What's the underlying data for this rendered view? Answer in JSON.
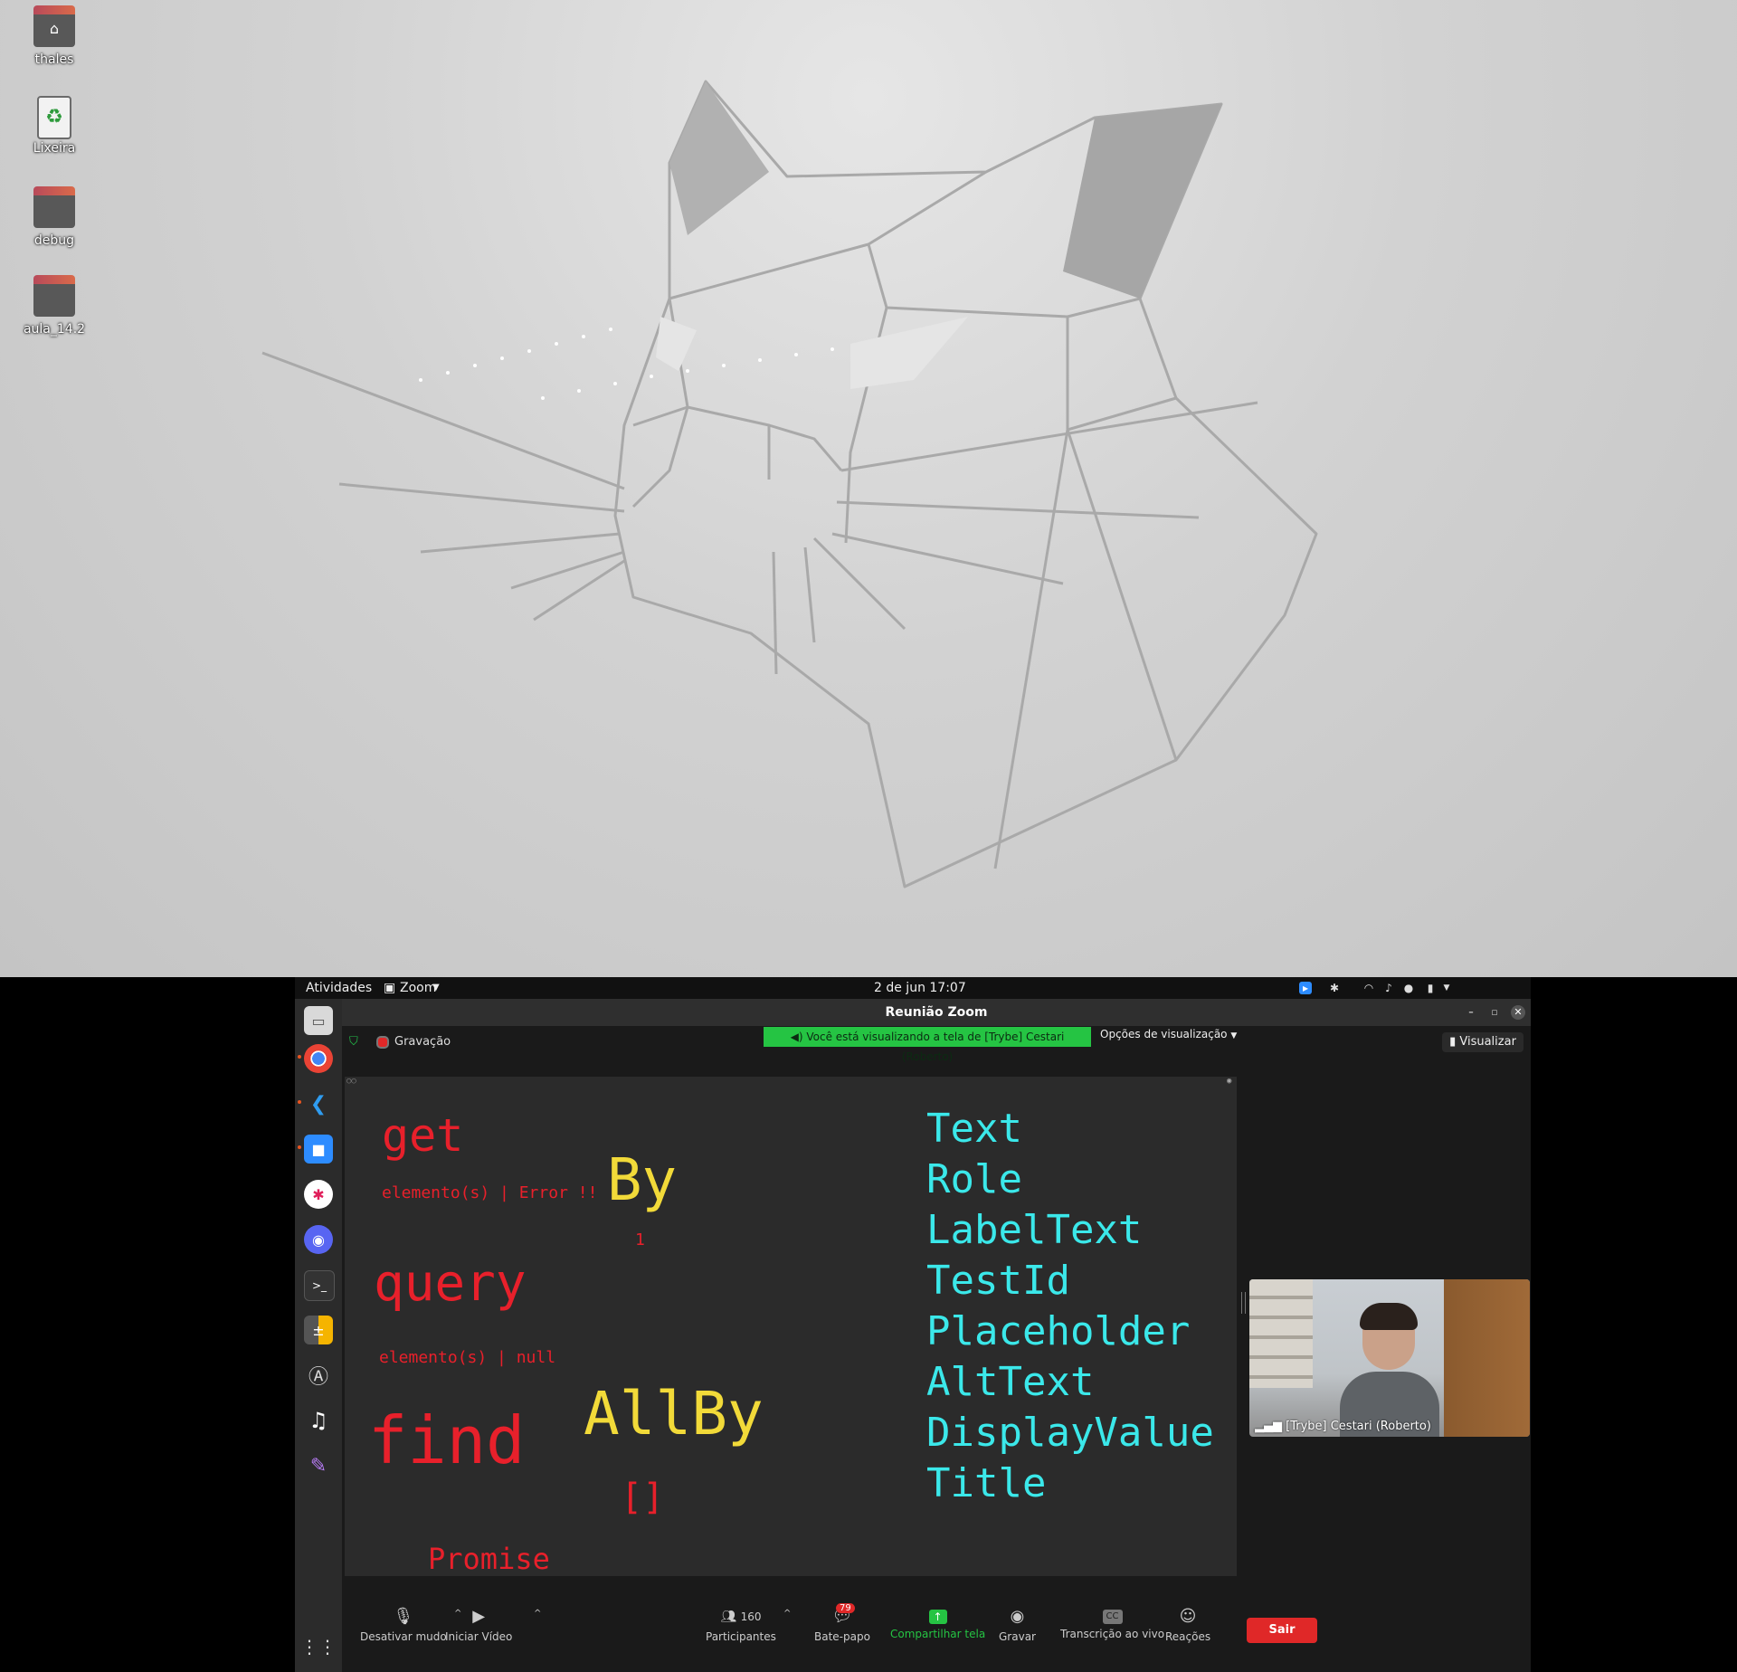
{
  "desktop": {
    "icons": [
      {
        "label": "thales"
      },
      {
        "label": "Lixeira"
      },
      {
        "label": "debug"
      },
      {
        "label": "aula_14.2"
      }
    ]
  },
  "topbar": {
    "activities": "Atividades",
    "app": "Zoom",
    "datetime": "2 de jun  17:07"
  },
  "zoom": {
    "window_title": "Reunião Zoom",
    "recording": "Gravação",
    "banner": "Você está visualizando a tela de [Trybe] Cestari (Roberto)",
    "view_options": "Opções de visualização",
    "visualizar": "Visualizar",
    "participant_name": "[Trybe] Cestari (Roberto)",
    "controls": {
      "mute": "Desativar mudo",
      "video": "Iniciar Vídeo",
      "participants": "Participantes",
      "participants_count": "160",
      "chat": "Bate-papo",
      "chat_badge": "79",
      "share": "Compartilhar tela",
      "record": "Gravar",
      "transcript": "Transcrição ao vivo",
      "reactions": "Reações",
      "leave": "Sair"
    }
  },
  "slide": {
    "get": "get",
    "get_desc": "elemento(s) | Error !!",
    "query": "query",
    "query_desc": "elemento(s) | null",
    "find": "find",
    "find_desc": "Promise",
    "by": "By",
    "by_count": "1",
    "allby": "AllBy",
    "allby_desc": "[]",
    "queries": [
      "Text",
      "Role",
      "LabelText",
      "TestId",
      "Placeholder",
      "AltText",
      "DisplayValue",
      "Title"
    ]
  },
  "colors": {
    "prefix": "#e8202b",
    "variant": "#f2da39",
    "query": "#3be8ea",
    "share_banner": "#25c443",
    "leave_button": "#e02828"
  }
}
